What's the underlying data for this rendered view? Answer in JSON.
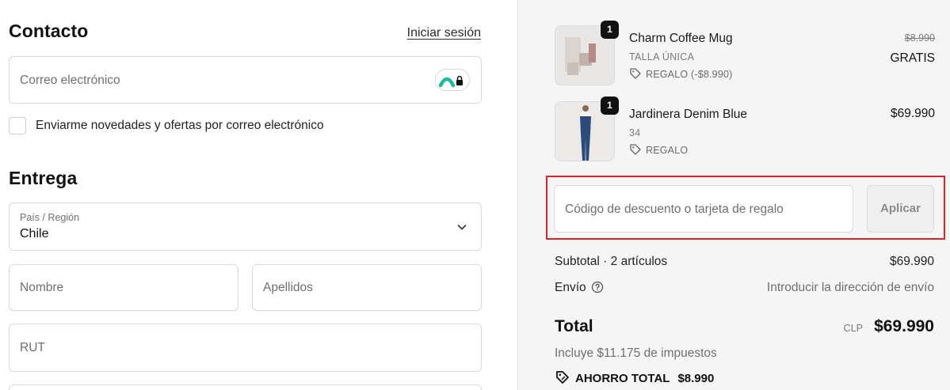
{
  "contact": {
    "title": "Contacto",
    "login_link": "Iniciar sesión",
    "email_placeholder": "Correo electrónico",
    "newsletter_label": "Enviarme novedades y ofertas por correo electrónico"
  },
  "delivery": {
    "title": "Entrega",
    "country_label": "País / Región",
    "country_value": "Chile",
    "first_name_placeholder": "Nombre",
    "last_name_placeholder": "Apellidos",
    "rut_placeholder": "RUT"
  },
  "cart": {
    "items": [
      {
        "name": "Charm Coffee Mug",
        "variant": "TALLA ÚNICA",
        "gift": "REGALO (-$8.990)",
        "original_price": "$8.990",
        "price": "GRATIS",
        "quantity": "1"
      },
      {
        "name": "Jardinera Denim Blue",
        "variant": "34",
        "gift": "REGALO",
        "price": "$69.990",
        "quantity": "1"
      }
    ],
    "discount_placeholder": "Código de descuento o tarjeta de regalo",
    "apply_label": "Aplicar",
    "subtotal_label": "Subtotal · 2 artículos",
    "subtotal_value": "$69.990",
    "shipping_label": "Envío",
    "shipping_value": "Introducir la dirección de envío",
    "total_label": "Total",
    "total_currency": "CLP",
    "total_value": "$69.990",
    "tax_note": "Incluye $11.175 de impuestos",
    "savings_label": "AHORRO TOTAL",
    "savings_value": "$8.990"
  },
  "colors": {
    "highlight_box": "#d8232a",
    "summary_bg": "#f5f5f5"
  }
}
